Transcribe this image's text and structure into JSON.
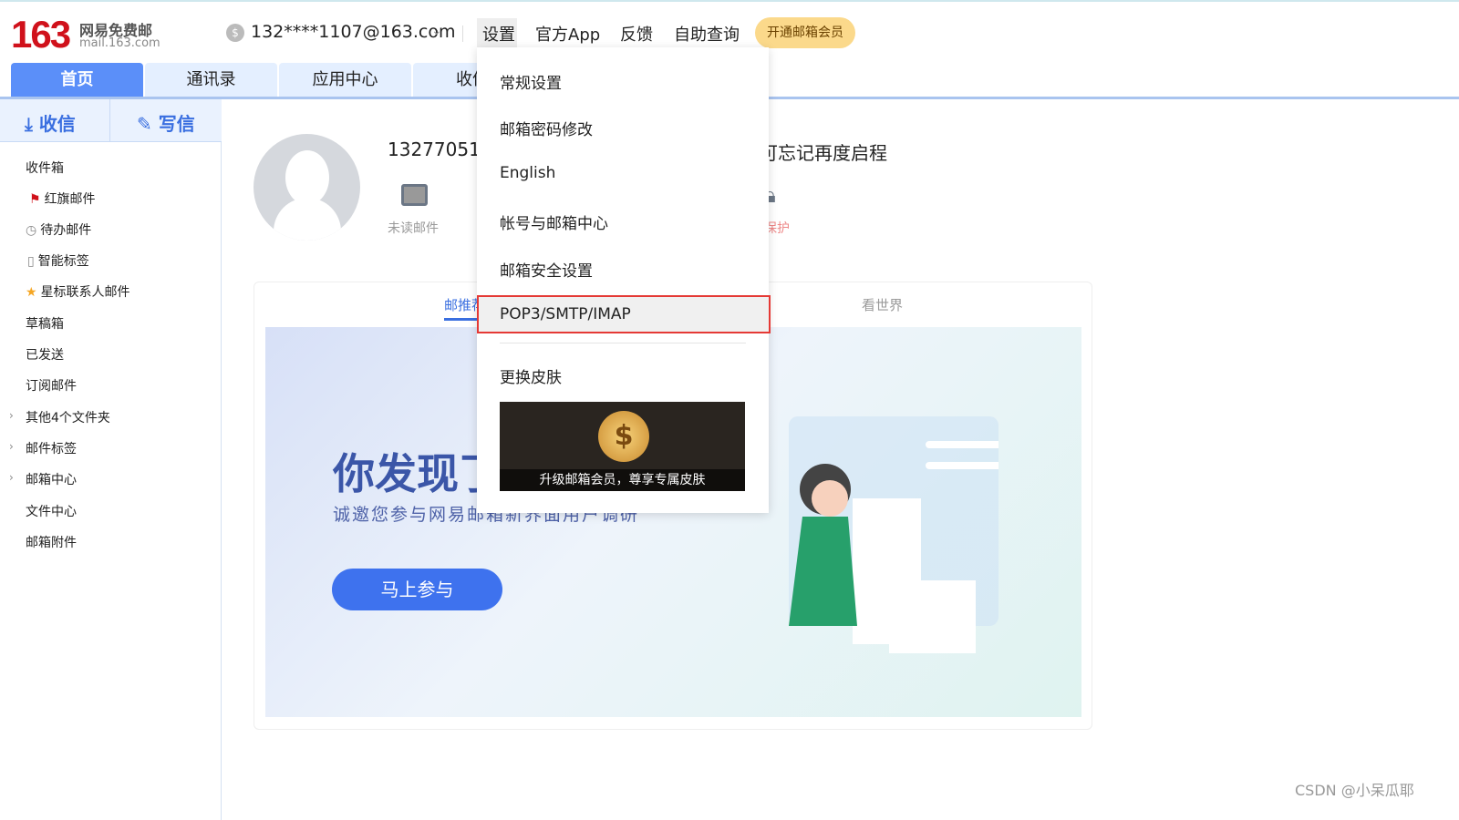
{
  "logo": {
    "number": "163",
    "cn": "网易免费邮",
    "domain": "mail.163.com"
  },
  "header": {
    "account": "132****1107@163.com",
    "nav": [
      "设置",
      "官方App",
      "反馈",
      "自助查询"
    ],
    "vip": "开通邮箱会员"
  },
  "tabs": [
    "首页",
    "通讯录",
    "应用中心",
    "收件箱"
  ],
  "actions": {
    "receive": "收信",
    "compose": "写信"
  },
  "folders": [
    {
      "label": "收件箱",
      "icon": ""
    },
    {
      "label": "红旗邮件",
      "icon": "flag-icon"
    },
    {
      "label": "待办邮件",
      "icon": "clock-icon"
    },
    {
      "label": "智能标签",
      "icon": "bookmark-icon"
    },
    {
      "label": "星标联系人邮件",
      "icon": "star-icon"
    },
    {
      "label": "草稿箱",
      "icon": ""
    },
    {
      "label": "已发送",
      "icon": ""
    },
    {
      "label": "订阅邮件",
      "icon": ""
    },
    {
      "label": "其他4个文件夹",
      "icon": "chevron-right-icon"
    },
    {
      "label": "邮件标签",
      "icon": "chevron-right-icon"
    },
    {
      "label": "邮箱中心",
      "icon": "chevron-right-icon"
    },
    {
      "label": "文件中心",
      "icon": ""
    },
    {
      "label": "邮箱附件",
      "icon": ""
    }
  ],
  "profile": {
    "name": "132770511",
    "slogan": "可忘记再度启程",
    "unread": "未读邮件",
    "protect": "保护"
  },
  "card": {
    "tabs": [
      "邮推荐",
      "看世界"
    ],
    "banner_title": "你发现了",
    "banner_sub": "诚邀您参与网易邮箱新界面用户调研",
    "banner_btn": "马上参与"
  },
  "dropdown": {
    "items": [
      "常规设置",
      "邮箱密码修改",
      "English",
      "帐号与邮箱中心",
      "邮箱安全设置",
      "POP3/SMTP/IMAP",
      "更换皮肤"
    ],
    "skin_caption": "升级邮箱会员，尊享专属皮肤",
    "highlight_color": "#e53935"
  },
  "watermark": "CSDN @小呆瓜耶"
}
